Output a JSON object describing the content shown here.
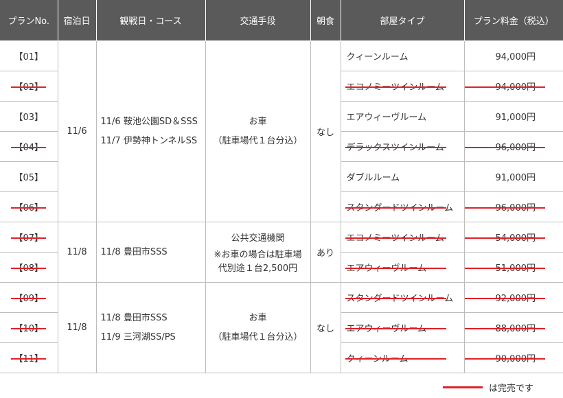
{
  "table": {
    "headers": {
      "plan_no": "プランNo.",
      "nights": "宿泊日",
      "course": "観戦日・コース",
      "transport": "交通手段",
      "breakfast": "朝食",
      "room_type": "部屋タイプ",
      "price": "プラン料金（税込）"
    },
    "groups": [
      {
        "night": "11/6",
        "course_lines": [
          "11/6 鞍池公園SD＆SSS",
          "11/7 伊勢神トンネルSS"
        ],
        "transport_main": "お車",
        "transport_note": [
          "（駐車場代１台分込）"
        ],
        "breakfast": "なし"
      },
      {
        "night": "11/8",
        "course_lines": [
          "11/8 豊田市SSS"
        ],
        "transport_main": "公共交通機関",
        "transport_note": [
          "※お車の場合は駐車場",
          "代別途１台2,500円"
        ],
        "breakfast": "あり"
      },
      {
        "night": "11/8",
        "course_lines": [
          "11/8 豊田市SSS",
          "11/9 三河湖SS/PS"
        ],
        "transport_main": "お車",
        "transport_note": [
          "（駐車場代１台分込）"
        ],
        "breakfast": "なし"
      }
    ],
    "rows": [
      {
        "plan": "【01】",
        "room": "クィーンルーム",
        "price": "94,000円",
        "sold_out": false
      },
      {
        "plan": "【02】",
        "room": "エコノミーツインルーム",
        "price": "94,000円",
        "sold_out": true
      },
      {
        "plan": "【03】",
        "room": "エアウィーヴルーム",
        "price": "91,000円",
        "sold_out": false
      },
      {
        "plan": "【04】",
        "room": "デラックスツインルーム",
        "price": "96,000円",
        "sold_out": true
      },
      {
        "plan": "【05】",
        "room": "ダブルルーム",
        "price": "91,000円",
        "sold_out": false
      },
      {
        "plan": "【06】",
        "room": "スタンダードツインルーム",
        "price": "96,000円",
        "sold_out": true
      },
      {
        "plan": "【07】",
        "room": "エコノミーツインルーム",
        "price": "54,000円",
        "sold_out": true
      },
      {
        "plan": "【08】",
        "room": "エアウィーヴルーム",
        "price": "51,000円",
        "sold_out": true
      },
      {
        "plan": "【09】",
        "room": "スタンダードツインルーム",
        "price": "92,000円",
        "sold_out": true
      },
      {
        "plan": "【10】",
        "room": "エアウィーヴルーム",
        "price": "88,000円",
        "sold_out": true
      },
      {
        "plan": "【11】",
        "room": "クィーンルーム",
        "price": "90,000円",
        "sold_out": true
      }
    ]
  },
  "legend": {
    "text": "は完売です",
    "strike_color": "#e21f26"
  },
  "colors": {
    "header_bg": "#5a5a5a",
    "header_text": "#ffffff",
    "border": "#bdbdbd",
    "sold_out_line": "#e21f26"
  }
}
